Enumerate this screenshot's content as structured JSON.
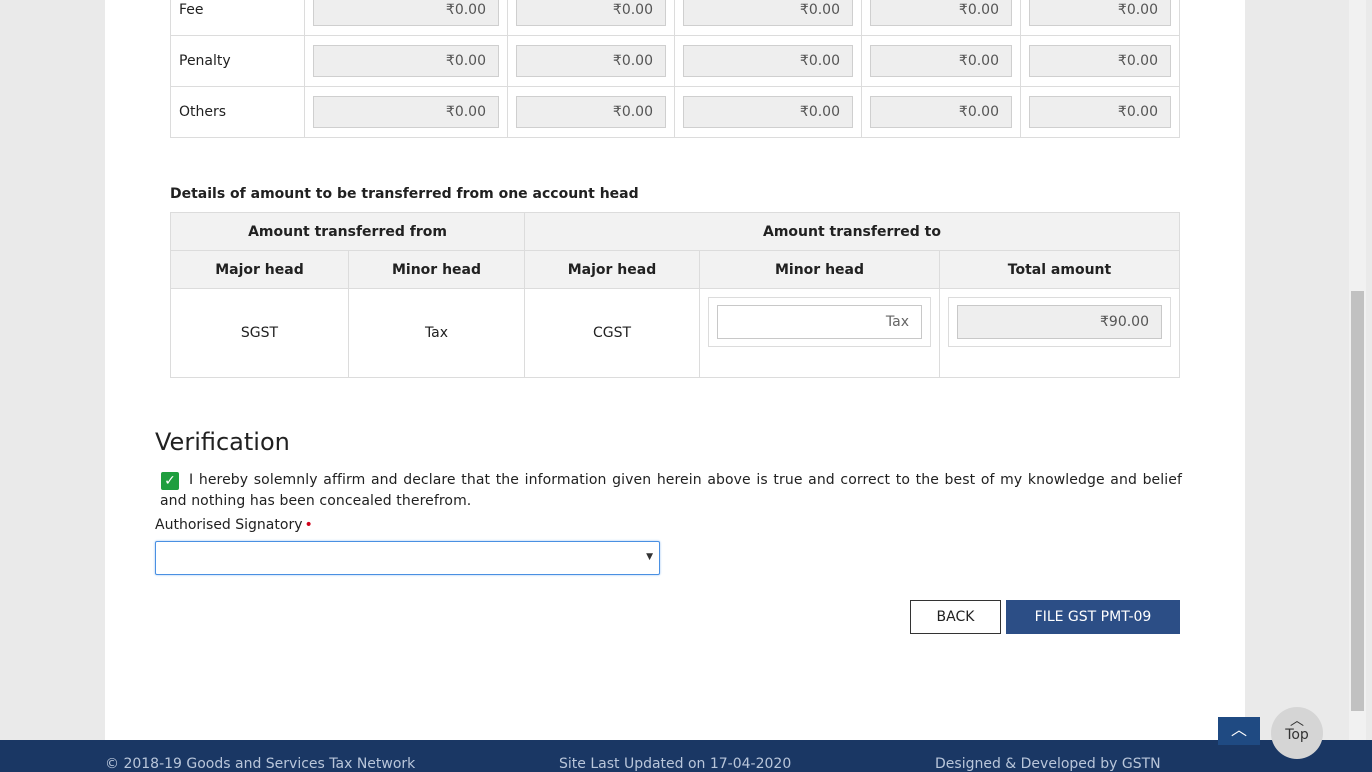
{
  "top_table": {
    "rows": [
      {
        "label": "Fee",
        "values": [
          "₹0.00",
          "₹0.00",
          "₹0.00",
          "₹0.00",
          "₹0.00"
        ]
      },
      {
        "label": "Penalty",
        "values": [
          "₹0.00",
          "₹0.00",
          "₹0.00",
          "₹0.00",
          "₹0.00"
        ]
      },
      {
        "label": "Others",
        "values": [
          "₹0.00",
          "₹0.00",
          "₹0.00",
          "₹0.00",
          "₹0.00"
        ]
      }
    ]
  },
  "transfer": {
    "title": "Details of amount to be transferred from one account head",
    "group_from": "Amount transferred from",
    "group_to": "Amount transferred to",
    "headers": [
      "Major head",
      "Minor head",
      "Major head",
      "Minor head",
      "Total amount"
    ],
    "row": {
      "from_major": "SGST",
      "from_minor": "Tax",
      "to_major": "CGST",
      "to_minor": "Tax",
      "total": "₹90.00"
    }
  },
  "verification": {
    "title": "Verification",
    "checkbox_mark": "✓",
    "declaration": "I hereby solemnly affirm and declare that the information given herein above is true and correct to the best of my knowledge and belief and nothing has been concealed therefrom.",
    "signatory_label": "Authorised Signatory",
    "required_mark": "•",
    "signatory_value": "",
    "select_caret": "▼"
  },
  "actions": {
    "back_label": "BACK",
    "file_label": "FILE GST PMT-09"
  },
  "footer": {
    "copyright": "© 2018-19 Goods and Services Tax Network",
    "updated": "Site Last Updated on 17-04-2020",
    "designed": "Designed & Developed by GSTN"
  },
  "top_button": {
    "arrow": "︿",
    "label": "Top"
  },
  "scroll_up_arrow": "︿"
}
